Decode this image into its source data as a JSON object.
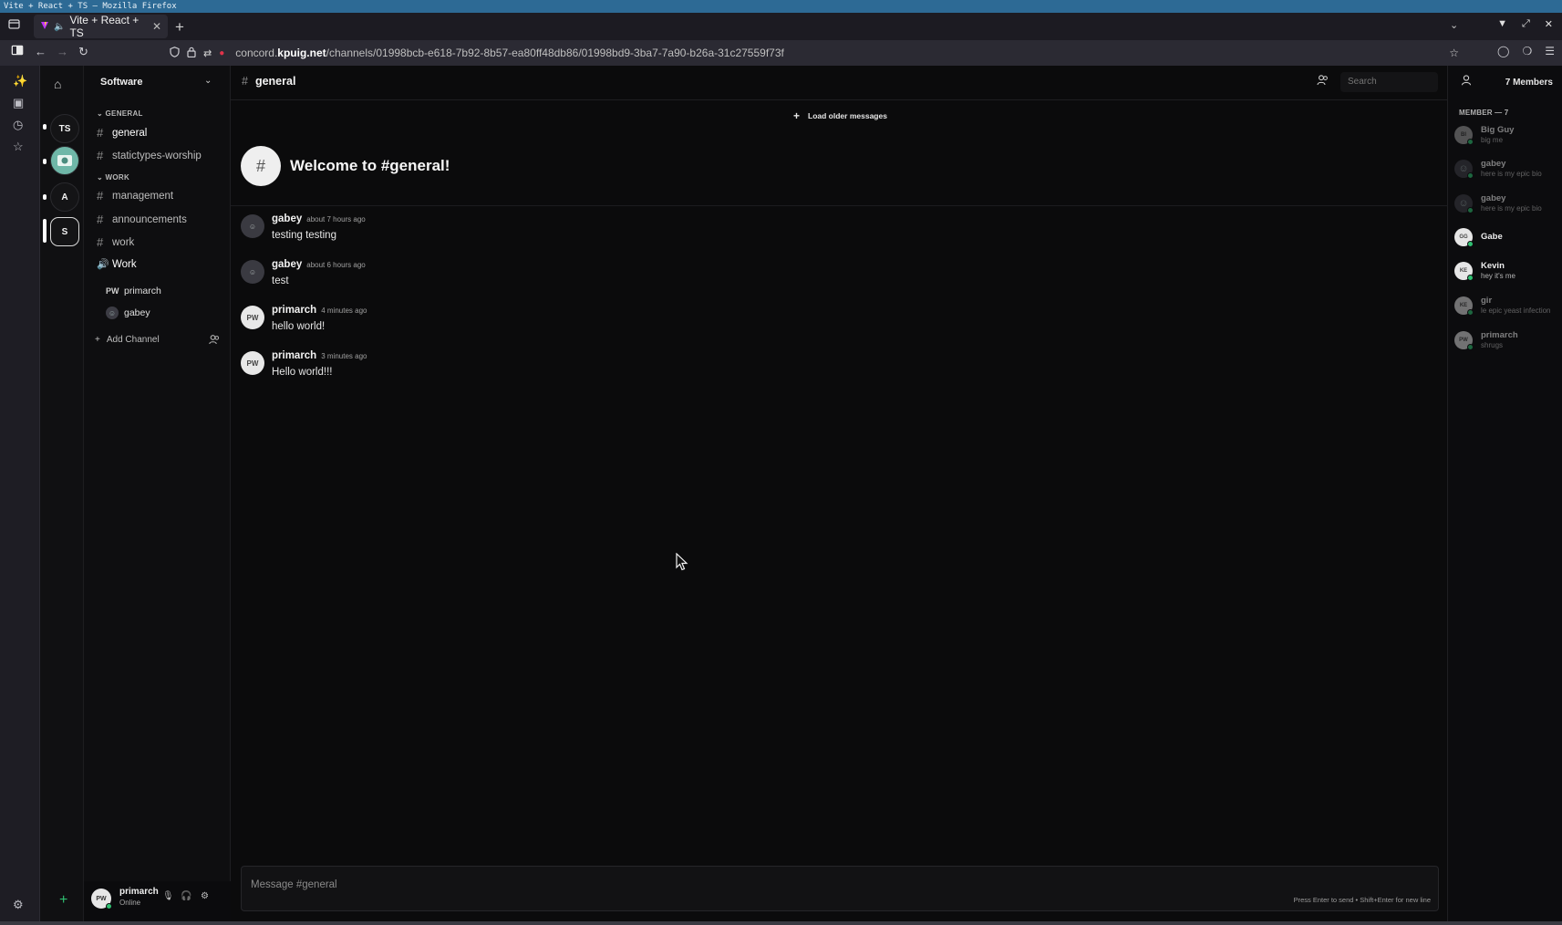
{
  "window": {
    "title": "Vite + React + TS — Mozilla Firefox"
  },
  "browser": {
    "tab": {
      "title": "Vite + React + TS"
    },
    "url": {
      "prefix": "concord.",
      "domain": "kpuig.net",
      "path": "/channels/01998bcb-e618-7b92-8b57-ea80ff48db86/01998bd9-3ba7-7a90-b26a-31c27559f73f"
    }
  },
  "servers": [
    {
      "label": "TS",
      "unread": true,
      "active": false
    },
    {
      "label": "",
      "unread": true,
      "active": false,
      "image": true
    },
    {
      "label": "A",
      "unread": true,
      "active": false
    },
    {
      "label": "S",
      "unread": false,
      "active": true
    }
  ],
  "sidebar": {
    "server_name": "Software",
    "categories": [
      {
        "name": "GENERAL",
        "channels": [
          "general",
          "statictypes-worship"
        ]
      },
      {
        "name": "WORK",
        "channels": [
          "management",
          "announcements",
          "work"
        ]
      }
    ],
    "voice_channel": {
      "name": "Work",
      "users": [
        {
          "badge": "PW",
          "name": "primarch"
        },
        {
          "badge": "face",
          "name": "gabey"
        }
      ]
    },
    "add_channel_label": "Add Channel"
  },
  "user_panel": {
    "initials": "PW",
    "name": "primarch",
    "status": "Online"
  },
  "channel": {
    "name": "general",
    "search_placeholder": "Search",
    "load_older_label": "Load older messages",
    "welcome": "Welcome to #general!"
  },
  "messages": [
    {
      "author": "gabey",
      "time": "about 7 hours ago",
      "text": "testing testing",
      "avatar": "face"
    },
    {
      "author": "gabey",
      "time": "about 6 hours ago",
      "text": "test",
      "avatar": "face"
    },
    {
      "author": "primarch",
      "time": "4 minutes ago",
      "text": "hello world!",
      "avatar": "PW"
    },
    {
      "author": "primarch",
      "time": "3 minutes ago",
      "text": "Hello world!!!",
      "avatar": "PW"
    }
  ],
  "composer": {
    "placeholder": "Message #general",
    "hint": "Press Enter to send • Shift+Enter for new line"
  },
  "member_list": {
    "count_label": "7 Members",
    "category": "MEMBER — 7",
    "members": [
      {
        "name": "Big Guy",
        "bio": "big me",
        "initials": "BI",
        "online": false
      },
      {
        "name": "gabey",
        "bio": "here is my epic bio",
        "initials": "face",
        "online": false
      },
      {
        "name": "gabey",
        "bio": "here is my epic bio",
        "initials": "face",
        "online": false
      },
      {
        "name": "Gabe",
        "bio": "",
        "initials": "GG",
        "online": true
      },
      {
        "name": "Kevin",
        "bio": "hey it's me",
        "initials": "KE",
        "online": true
      },
      {
        "name": "gir",
        "bio": "le epic yeast infection",
        "initials": "KE",
        "online": false
      },
      {
        "name": "primarch",
        "bio": "shrugs",
        "initials": "PW",
        "online": false
      }
    ]
  },
  "colors": {
    "online": "#2fbf71",
    "background": "#0b0b0c",
    "title_bar": "#2d6a95"
  }
}
